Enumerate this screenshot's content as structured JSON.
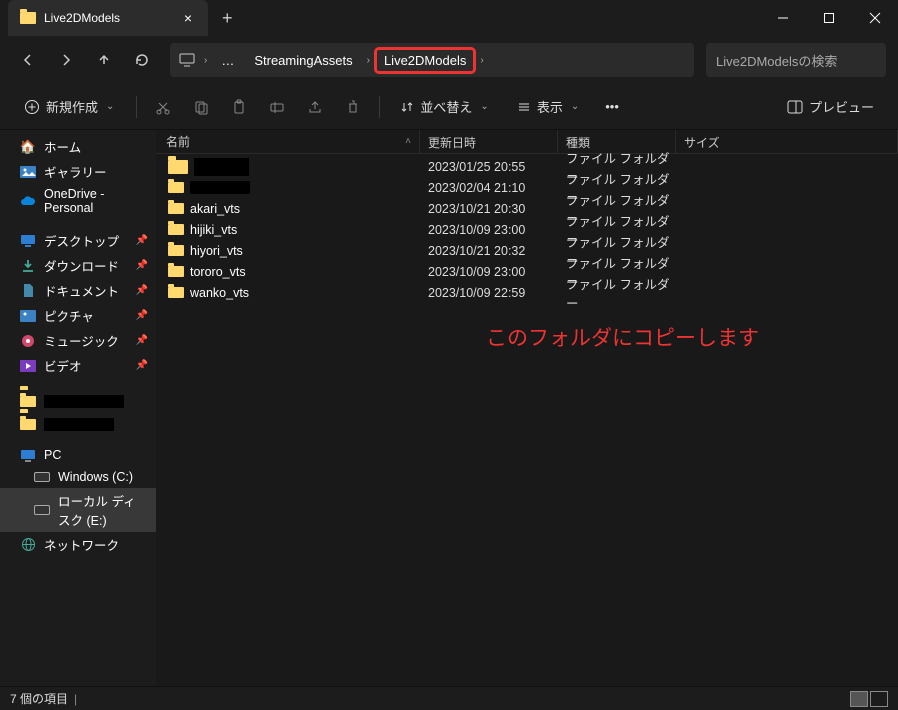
{
  "titlebar": {
    "tab_title": "Live2DModels",
    "close_glyph": "×",
    "newtab_glyph": "+"
  },
  "address": {
    "parent_path": "StreamingAssets",
    "current_path": "Live2DModels",
    "ellipsis": "…",
    "search_placeholder": "Live2DModelsの検索"
  },
  "toolbar": {
    "new_label": "新規作成",
    "sort_label": "並べ替え",
    "view_label": "表示",
    "preview_label": "プレビュー"
  },
  "sidebar": {
    "home": "ホーム",
    "gallery": "ギャラリー",
    "onedrive": "OneDrive - Personal",
    "desktop": "デスクトップ",
    "downloads": "ダウンロード",
    "documents": "ドキュメント",
    "pictures": "ピクチャ",
    "music": "ミュージック",
    "videos": "ビデオ",
    "pc": "PC",
    "c_drive": "Windows (C:)",
    "e_drive": "ローカル ディスク (E:)",
    "network": "ネットワーク"
  },
  "columns": {
    "name": "名前",
    "date": "更新日時",
    "type": "種類",
    "size": "サイズ"
  },
  "rows": [
    {
      "name": "",
      "redacted": true,
      "date": "2023/01/25 20:55",
      "type": "ファイル フォルダー"
    },
    {
      "name": "",
      "redacted": true,
      "date": "2023/02/04 21:10",
      "type": "ファイル フォルダー"
    },
    {
      "name": "akari_vts",
      "date": "2023/10/21 20:30",
      "type": "ファイル フォルダー"
    },
    {
      "name": "hijiki_vts",
      "date": "2023/10/09 23:00",
      "type": "ファイル フォルダー"
    },
    {
      "name": "hiyori_vts",
      "date": "2023/10/21 20:32",
      "type": "ファイル フォルダー"
    },
    {
      "name": "tororo_vts",
      "date": "2023/10/09 23:00",
      "type": "ファイル フォルダー"
    },
    {
      "name": "wanko_vts",
      "date": "2023/10/09 22:59",
      "type": "ファイル フォルダー"
    }
  ],
  "annotation": "このフォルダにコピーします",
  "status": {
    "item_count": "7 個の項目"
  }
}
